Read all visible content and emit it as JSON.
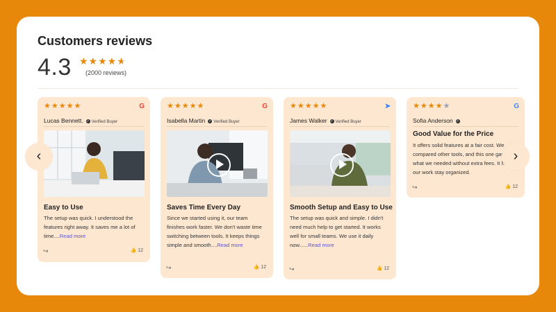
{
  "header": {
    "title": "Customers reviews",
    "rating": "4.3",
    "stars": "★★★★",
    "half_star": "★",
    "count": "(2000 reviews)"
  },
  "reviews": [
    {
      "stars": "★★★★★",
      "stars_off": "",
      "source": "G",
      "source_color": "#EA4335",
      "name": "Lucas Bennett.",
      "verified": "Verified Buyer",
      "title": "Easy to Use",
      "body": "The setup was quick. I understood the features right away. It saves me a lot of time....",
      "more": "Read more",
      "likes": "12",
      "has_video": false
    },
    {
      "stars": "★★★★★",
      "stars_off": "",
      "source": "G",
      "source_color": "#EA4335",
      "name": "Isabella Martin",
      "verified": "Verified Buyer",
      "title": "Saves Time Every Day",
      "body": "Since we started using it, our team finishes  work faster. We don't waste time switching between tools. It keeps things simple  and smooth....",
      "more": "Read more",
      "likes": "12",
      "has_video": true
    },
    {
      "stars": "★★★★★",
      "stars_off": "",
      "source": "➤",
      "source_color": "#3b82f6",
      "name": "James Walker",
      "verified": "Verified Buyer",
      "title": "Smooth Setup and Easy to Use",
      "body": "The setup was quick and simple. I didn't need much help to get started. It works well for small teams. We use it daily now......",
      "more": "Read more",
      "likes": "12",
      "has_video": true
    },
    {
      "stars": "★★★★",
      "stars_off": "★",
      "source": "G",
      "source_color": "#4285F4",
      "name": "Sofia Anderson",
      "verified": "",
      "title": "Good Value for the Price",
      "body": "It offers solid features at a fair cost. We compared other tools, and this one gave us what we needed without extra fees. It helps our work stay organized.",
      "more": "",
      "likes": "12",
      "has_video": false
    }
  ],
  "nav": {
    "prev": "‹",
    "next": "›"
  },
  "icons": {
    "share": "share-icon",
    "like": "thumbs-up-icon",
    "verified": "check-badge-icon"
  },
  "colors": {
    "accent": "#E8880A",
    "card": "#FDE7D0",
    "link": "#5b52d6"
  }
}
